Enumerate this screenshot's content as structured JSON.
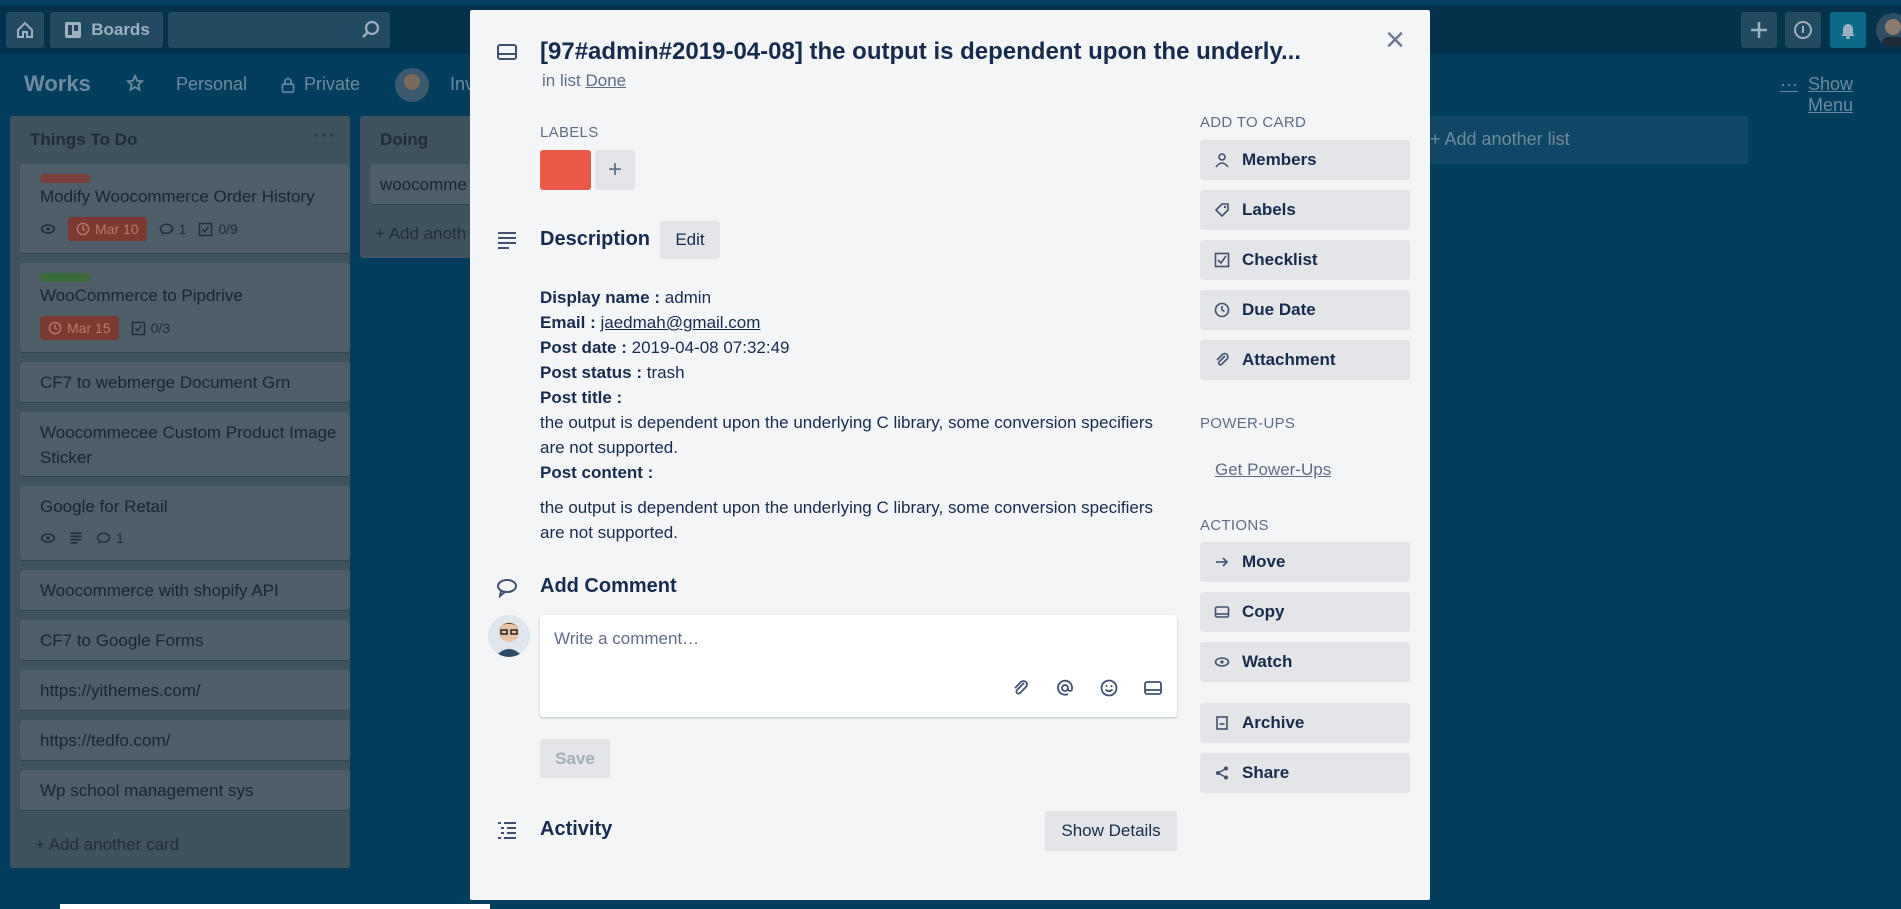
{
  "header": {
    "home_label": "",
    "boards_label": "Boards",
    "search_placeholder": ""
  },
  "board": {
    "title": "Works",
    "team": "Personal",
    "visibility": "Private",
    "invite": "Inv",
    "show_menu": "Show Menu",
    "add_list": "+ Add another list"
  },
  "lists": [
    {
      "title": "Things To Do",
      "menu": "···",
      "cards": [
        {
          "title": "Modify Woocommerce Order History",
          "label_color": "#7a3f38",
          "due": "Mar 10",
          "comments": "1",
          "checklist": "0/9"
        },
        {
          "title": "WooCommerce to Pipdrive",
          "label_color": "#3b6a3a",
          "due": "Mar 15",
          "checklist": "0/3"
        },
        {
          "title": "CF7 to webmerge Document Grn"
        },
        {
          "title_line1": "Woocommecee Custom Product Image",
          "title_line2": "Sticker"
        },
        {
          "title": "Google for Retail",
          "comments": "1"
        },
        {
          "title": "Woocommerce with shopify API"
        },
        {
          "title": "CF7 to Google Forms"
        },
        {
          "title": "https://yithemes.com/"
        },
        {
          "title": "https://tedfo.com/"
        },
        {
          "title": "Wp school management sys"
        }
      ],
      "add_card": "+ Add another card"
    },
    {
      "title": "Doing",
      "cards": [
        {
          "title": "woocomme"
        }
      ],
      "add_card": "+ Add anoth"
    }
  ],
  "modal": {
    "title": "[97#admin#2019-04-08] the output is dependent upon the underly...",
    "in_list_prefix": "in list",
    "in_list": "Done",
    "labels_heading": "LABELS",
    "label_color": "#eb5a46",
    "description_heading": "Description",
    "edit_label": "Edit",
    "description": {
      "display_name_key": "Display name :",
      "display_name": "admin",
      "email_key": "Email :",
      "email": "jaedmah@gmail.com",
      "post_date_key": "Post date :",
      "post_date": "2019-04-08 07:32:49",
      "post_status_key": "Post status :",
      "post_status": "trash",
      "post_title_key": "Post title :",
      "post_title_line1": "the output is dependent upon the underlying C library, some conversion specifiers",
      "post_title_line2": "are not supported.",
      "post_content_key": "Post content :",
      "post_content_line1": "the output is dependent upon the underlying C library, some conversion specifiers",
      "post_content_line2": "are not supported."
    },
    "add_comment_heading": "Add Comment",
    "comment_placeholder": "Write a comment…",
    "save_label": "Save",
    "activity_heading": "Activity",
    "show_details_label": "Show Details",
    "sidebar": {
      "add_to_card_heading": "ADD TO CARD",
      "add_to_card": [
        "Members",
        "Labels",
        "Checklist",
        "Due Date",
        "Attachment"
      ],
      "powerups_heading": "POWER-UPS",
      "get_powerups": "Get Power-Ups",
      "actions_heading": "ACTIONS",
      "actions": [
        "Move",
        "Copy",
        "Watch",
        "Archive",
        "Share"
      ]
    }
  }
}
